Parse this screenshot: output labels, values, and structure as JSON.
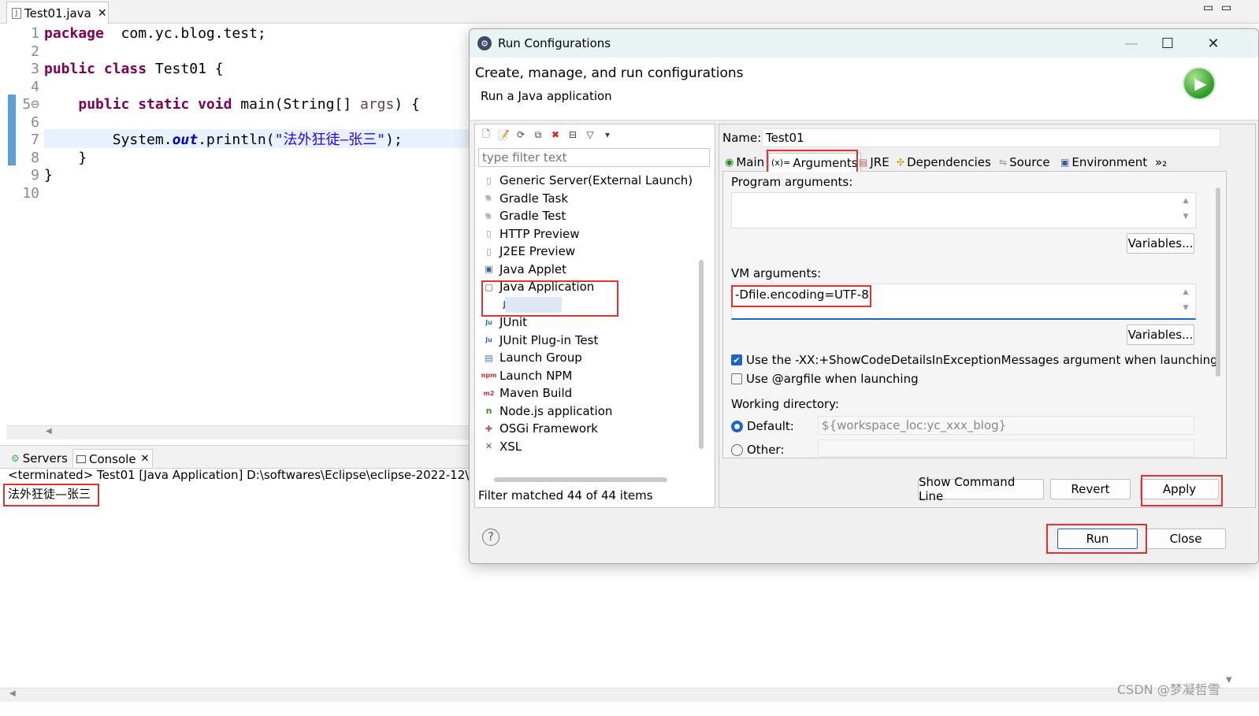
{
  "editor": {
    "tab_label": "Test01.java",
    "lines": [
      {
        "n": "1",
        "segments": [
          [
            "kw",
            "package"
          ],
          [
            "",
            "  com.yc.blog.test;"
          ]
        ]
      },
      {
        "n": "2",
        "segments": []
      },
      {
        "n": "3",
        "segments": [
          [
            "kw",
            "public class"
          ],
          [
            "",
            " Test01 {"
          ]
        ]
      },
      {
        "n": "4",
        "segments": []
      },
      {
        "n": "5⊖",
        "segments": [
          [
            "",
            "    "
          ],
          [
            "kw",
            "public static void"
          ],
          [
            "",
            " main(String[] "
          ],
          [
            "pa",
            "args"
          ],
          [
            "",
            ") {"
          ]
        ]
      },
      {
        "n": "6",
        "segments": []
      },
      {
        "n": "7",
        "segments": [
          [
            "",
            "        System."
          ],
          [
            "fd",
            "out"
          ],
          [
            "",
            ".println("
          ],
          [
            "st",
            "\"法外狂徒—张三\""
          ],
          [
            "",
            ");"
          ]
        ]
      },
      {
        "n": "8",
        "segments": [
          [
            "",
            "    }"
          ]
        ]
      },
      {
        "n": "9",
        "segments": [
          [
            "",
            "}"
          ]
        ]
      },
      {
        "n": "10",
        "segments": []
      }
    ]
  },
  "bottom_panel": {
    "servers_tab": "Servers",
    "console_tab": "Console",
    "status_line": "<terminated> Test01 [Java Application] D:\\softwares\\Eclipse\\eclipse-2022-12\\eclip",
    "output": "法外狂徒—张三"
  },
  "dialog": {
    "title": "Run Configurations",
    "header_title": "Create, manage, and run configurations",
    "header_subtitle": "Run a Java application",
    "filter_placeholder": "type filter text",
    "config_types": [
      {
        "label": "Generic Server(External Launch)",
        "icon": "server-icon"
      },
      {
        "label": "Gradle Task",
        "icon": "gradle-icon"
      },
      {
        "label": "Gradle Test",
        "icon": "gradle-icon"
      },
      {
        "label": "HTTP Preview",
        "icon": "server-icon"
      },
      {
        "label": "J2EE Preview",
        "icon": "server-icon"
      },
      {
        "label": "Java Applet",
        "icon": "applet-icon"
      },
      {
        "label": "Java Application",
        "icon": "java-app-icon"
      },
      {
        "label": "Test01",
        "icon": "java-file-icon",
        "child": true
      },
      {
        "label": "JUnit",
        "icon": "junit-icon"
      },
      {
        "label": "JUnit Plug-in Test",
        "icon": "junit-icon"
      },
      {
        "label": "Launch Group",
        "icon": "launch-group-icon"
      },
      {
        "label": "Launch NPM",
        "icon": "npm-icon"
      },
      {
        "label": "Maven Build",
        "icon": "maven-icon"
      },
      {
        "label": "Node.js application",
        "icon": "nodejs-icon"
      },
      {
        "label": "OSGi Framework",
        "icon": "osgi-icon"
      },
      {
        "label": "XSL",
        "icon": "xsl-icon"
      }
    ],
    "filter_status": "Filter matched 44 of 44 items",
    "name_label": "Name:",
    "name_value": "Test01",
    "tabs": [
      "Main",
      "Arguments",
      "JRE",
      "Dependencies",
      "Source",
      "Environment",
      "»₂"
    ],
    "program_args_label": "Program arguments:",
    "variables_label": "Variables...",
    "vm_args_label": "VM arguments:",
    "vm_args_value": "-Dfile.encoding=UTF-8",
    "checkbox1": "Use the -XX:+ShowCodeDetailsInExceptionMessages argument when launching",
    "checkbox2": "Use @argfile when launching",
    "working_dir_label": "Working directory:",
    "default_label": "Default:",
    "default_value": "${workspace_loc:yc_xxx_blog}",
    "other_label": "Other:",
    "buttons": {
      "show_cmd": "Show Command Line",
      "revert": "Revert",
      "apply": "Apply",
      "run": "Run",
      "close": "Close"
    }
  },
  "watermark": "CSDN @梦凝哲雪",
  "colors": {
    "highlight": "#e53030",
    "accent": "#1e63c8",
    "keyword": "#7f0055",
    "string": "#2a00ff"
  }
}
